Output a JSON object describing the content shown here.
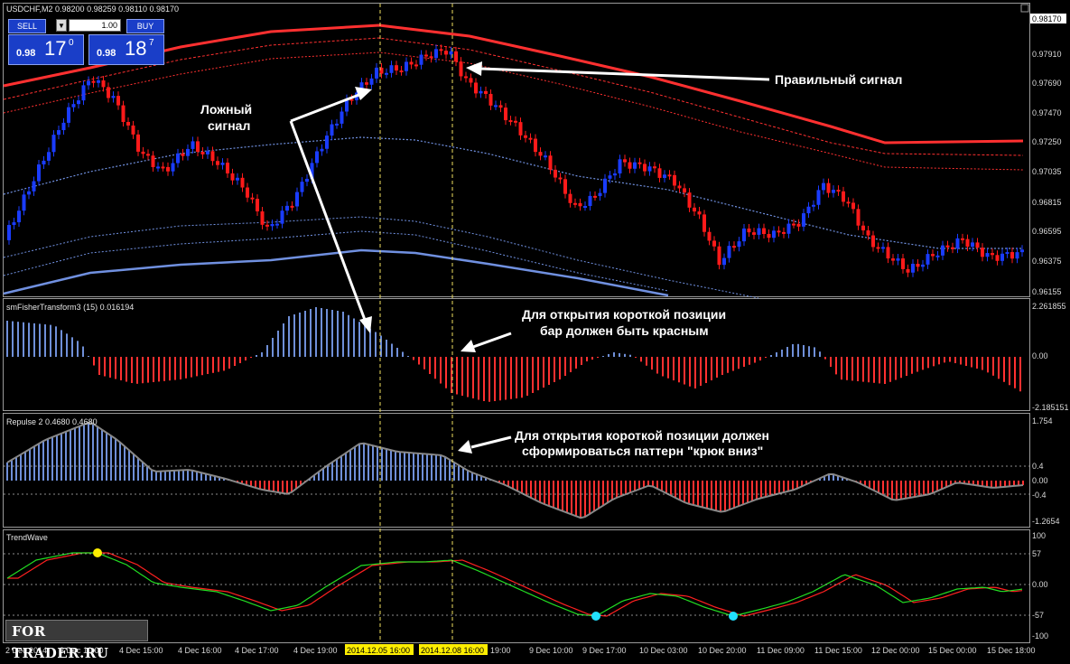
{
  "window": {
    "symbol_title": "USDCHF,M2",
    "ohlc": "0.98200 0.98259 0.98110 0.98170"
  },
  "trade_panel": {
    "sell_label": "SELL",
    "buy_label": "BUY",
    "lot_value": "1.00",
    "sell_big": "0.98",
    "sell_pips": "17",
    "sell_sup": "0",
    "buy_big": "0.98",
    "buy_pips": "18",
    "buy_sup": "7"
  },
  "price_axis": {
    "current_price": "0.98170",
    "ticks": [
      "0.97910",
      "0.97690",
      "0.97470",
      "0.97250",
      "0.97035",
      "0.96815",
      "0.96595",
      "0.96375",
      "0.96155"
    ]
  },
  "indicators": {
    "fisher": {
      "title": "smFisherTransform3 (15) 0.016194",
      "max": "2.261855",
      "zero": "0.00",
      "min": "-2.185151"
    },
    "repulse": {
      "title": "Repulse 2 0.4680 0.4680",
      "max": "1.754",
      "p04": "0.4",
      "zero": "0.00",
      "m04": "-0.4",
      "min": "-1.2654"
    },
    "trendwave": {
      "title": "TrendWave",
      "t100": "100",
      "t57": "57",
      "t0": "0.00",
      "tm57": "-57",
      "tm100": "-100"
    }
  },
  "time_axis": {
    "labels": [
      "2 Dec 2014",
      "3 Dec 10:00",
      "4 Dec 15:00",
      "4 Dec 16:00",
      "4 Dec 17:00",
      "4 Dec 19:00",
      "2014.12.05 16:00",
      "2014.12.08 16:00",
      "19:00",
      "9 Dec 10:00",
      "9 Dec 17:00",
      "10 Dec 03:00",
      "10 Dec 20:00",
      "11 Dec 09:00",
      "11 Dec 15:00",
      "12 Dec 00:00",
      "15 Dec 00:00",
      "15 Dec 18:00"
    ]
  },
  "annotations": {
    "false_signal_1": "Ложный",
    "false_signal_2": "сигнал",
    "correct_signal": "Правильный сигнал",
    "fisher_note_1": "Для открытия короткой позиции",
    "fisher_note_2": "бар должен быть красным",
    "repulse_note_1": "Для открытия короткой позиции должен",
    "repulse_note_2": "сформироваться паттерн \"крюк вниз\""
  },
  "watermark": "FOR TRADER.RU",
  "colors": {
    "bull": "#1a3cff",
    "bear": "#ff1a1a",
    "hist_pos": "#6f8fd8",
    "hist_neg": "#ff3030",
    "line_green": "#22dd22",
    "line_red": "#ff2020",
    "band": "#ff3030",
    "band_blue": "#7090e0"
  }
}
